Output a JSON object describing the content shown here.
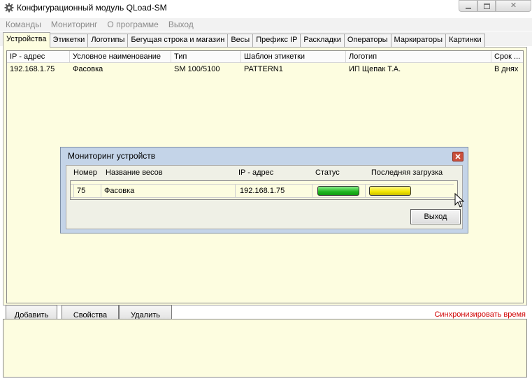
{
  "window": {
    "title": "Конфигурационный модуль QLoad-SM",
    "app_icon": "gear-icon",
    "controls": [
      "minimize-icon",
      "maximize-icon",
      "close-icon"
    ]
  },
  "menu": [
    {
      "label": "Команды"
    },
    {
      "label": "Мониторинг"
    },
    {
      "label": "О программе"
    },
    {
      "label": "Выход"
    }
  ],
  "tabs": [
    {
      "label": "Устройства",
      "active": true
    },
    {
      "label": "Этикетки"
    },
    {
      "label": "Логотипы"
    },
    {
      "label": "Бегущая строка и магазин"
    },
    {
      "label": "Весы"
    },
    {
      "label": "Префикс IP"
    },
    {
      "label": "Раскладки"
    },
    {
      "label": "Операторы"
    },
    {
      "label": "Маркираторы"
    },
    {
      "label": "Картинки"
    }
  ],
  "devices": {
    "columns": [
      "IP - адрес",
      "Условное наименование",
      "Тип",
      "Шаблон этикетки",
      "Логотип",
      "Срок ..."
    ],
    "rows": [
      [
        "192.168.1.75",
        "Фасовка",
        "SM 100/5100",
        "PATTERN1",
        "ИП Щепак Т.А.",
        "В днях"
      ]
    ]
  },
  "buttons": {
    "add": "Добавить",
    "properties": "Свойства",
    "delete": "Удалить",
    "sync_time": "Синхронизировать время"
  },
  "dialog": {
    "title": "Мониторинг устройств",
    "columns": [
      "Номер",
      "Название весов",
      "IP - адрес",
      "Статус",
      "Последняя загрузка"
    ],
    "rows": [
      {
        "number": "75",
        "name": "Фасовка",
        "ip": "192.168.1.75",
        "status_color": "#2ecc2e",
        "last_load_color": "#f2e600"
      }
    ],
    "exit": "Выход"
  },
  "colors": {
    "panel_bg": "#fdfde0",
    "dialog_frame": "#c4d4e8",
    "link_red": "#d00000",
    "status_ok": "#2ecc2e",
    "status_load": "#f2e600"
  }
}
